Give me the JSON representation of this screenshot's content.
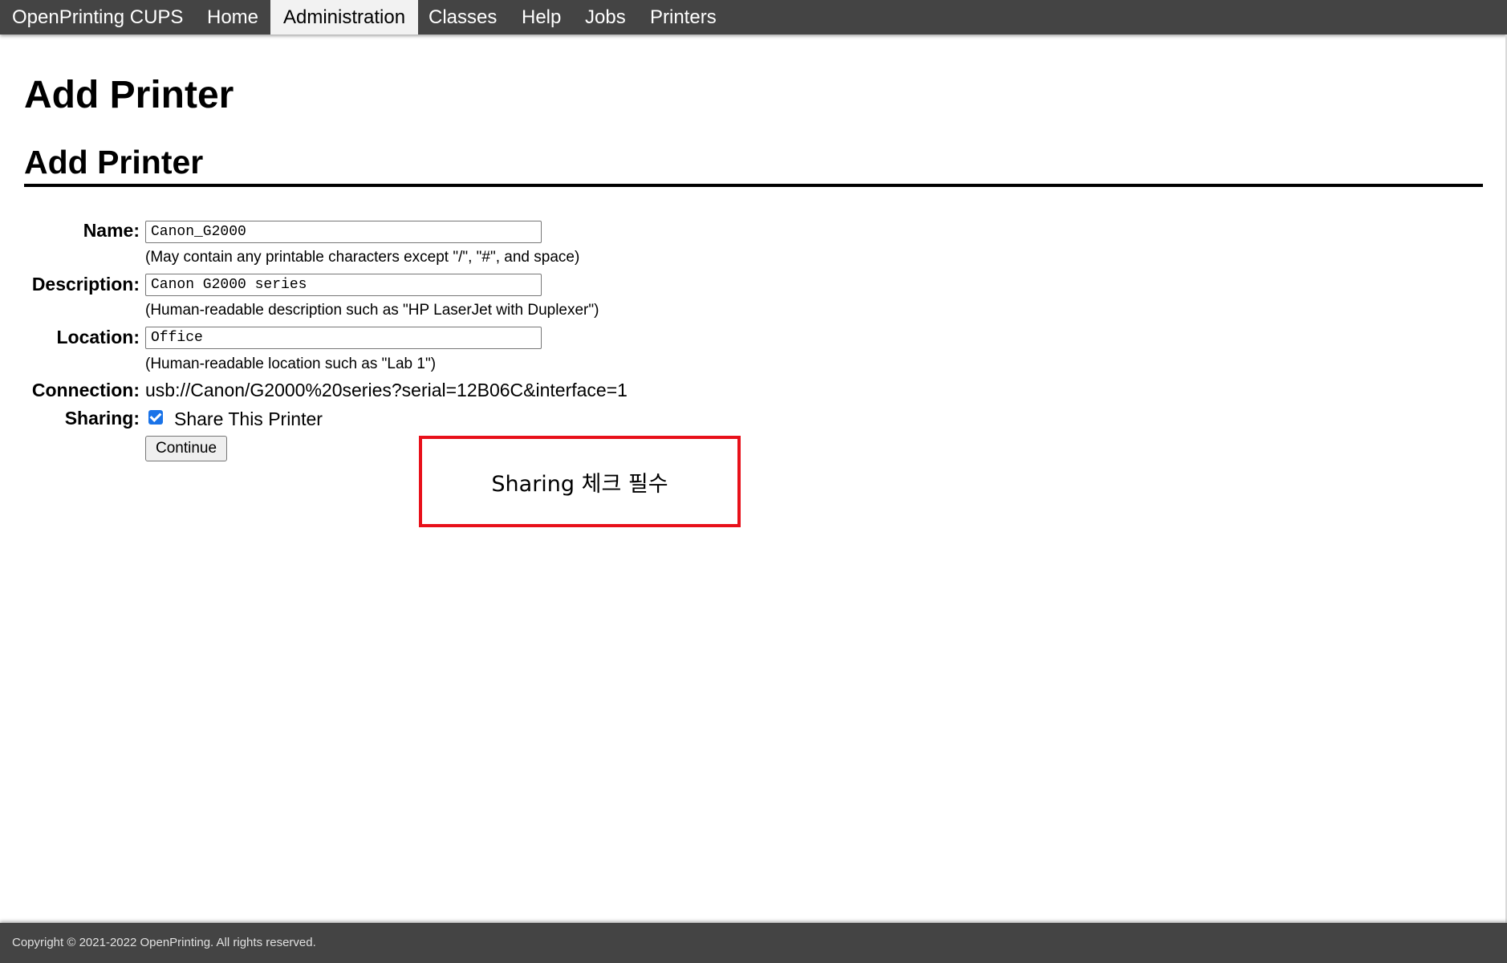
{
  "nav": {
    "brand": "OpenPrinting CUPS",
    "items": [
      {
        "label": "Home",
        "active": false
      },
      {
        "label": "Administration",
        "active": true
      },
      {
        "label": "Classes",
        "active": false
      },
      {
        "label": "Help",
        "active": false
      },
      {
        "label": "Jobs",
        "active": false
      },
      {
        "label": "Printers",
        "active": false
      }
    ]
  },
  "page": {
    "title": "Add Printer",
    "section_title": "Add Printer"
  },
  "form": {
    "name": {
      "label": "Name:",
      "value": "Canon_G2000",
      "hint": "(May contain any printable characters except \"/\", \"#\", and space)"
    },
    "description": {
      "label": "Description:",
      "value": "Canon G2000 series",
      "hint": "(Human-readable description such as \"HP LaserJet with Duplexer\")"
    },
    "location": {
      "label": "Location:",
      "value": "Office",
      "hint": "(Human-readable location such as \"Lab 1\")"
    },
    "connection": {
      "label": "Connection:",
      "value": "usb://Canon/G2000%20series?serial=12B06C&interface=1"
    },
    "sharing": {
      "label": "Sharing:",
      "checked": true,
      "checkbox_label": "Share This Printer"
    },
    "continue_label": "Continue"
  },
  "annotation": {
    "text": "Sharing 체크 필수",
    "color": "#e8101a"
  },
  "footer": {
    "copyright": "Copyright © 2021-2022 OpenPrinting. All rights reserved."
  },
  "colors": {
    "navbar": "#444444",
    "active_tab": "#f2f2f2",
    "checkbox": "#1a73e8"
  }
}
